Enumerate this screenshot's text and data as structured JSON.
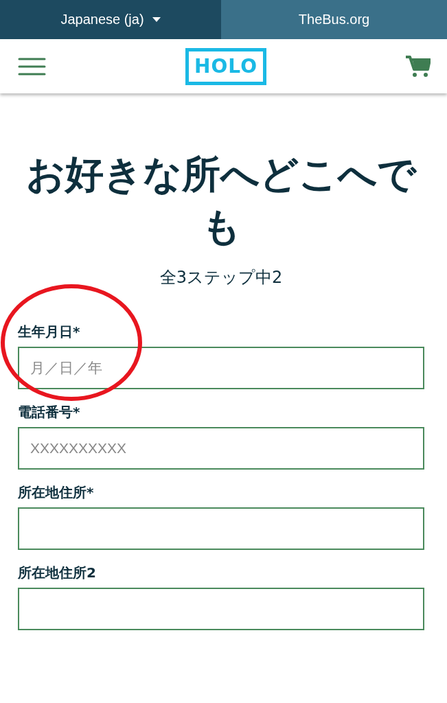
{
  "top_bar": {
    "language": "Japanese (ja)",
    "link": "TheBus.org"
  },
  "header": {
    "logo": "HOLO"
  },
  "title": "お好きな所へどこへでも",
  "step": "全3ステップ中2",
  "fields": [
    {
      "label": "生年月日*",
      "placeholder": "月／日／年",
      "highlighted": true
    },
    {
      "label": "電話番号*",
      "placeholder": "XXXXXXXXXX",
      "highlighted": false
    },
    {
      "label": "所在地住所*",
      "highlighted": false
    },
    {
      "label": "所在地住所2",
      "highlighted": false
    }
  ]
}
